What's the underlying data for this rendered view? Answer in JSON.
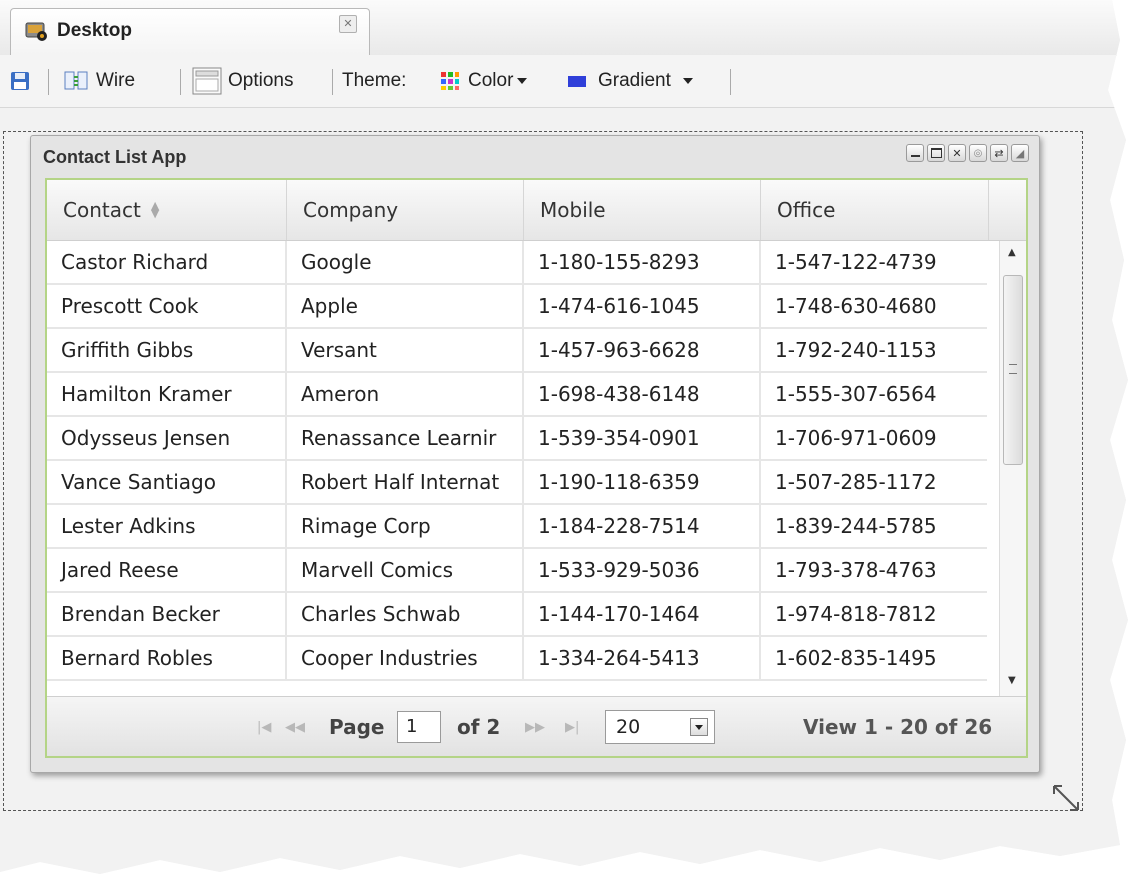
{
  "tab": {
    "title": "Desktop"
  },
  "toolbar": {
    "wire_label": "Wire",
    "options_label": "Options",
    "theme_label": "Theme:",
    "color_label": "Color",
    "gradient_label": "Gradient"
  },
  "window": {
    "title": "Contact List App"
  },
  "grid": {
    "columns": [
      "Contact",
      "Company",
      "Mobile",
      "Office"
    ],
    "rows": [
      [
        "Castor Richard",
        "Google",
        "1-180-155-8293",
        "1-547-122-4739"
      ],
      [
        "Prescott Cook",
        "Apple",
        "1-474-616-1045",
        "1-748-630-4680"
      ],
      [
        "Griffith Gibbs",
        "Versant",
        "1-457-963-6628",
        "1-792-240-1153"
      ],
      [
        "Hamilton Kramer",
        "Ameron",
        "1-698-438-6148",
        "1-555-307-6564"
      ],
      [
        "Odysseus Jensen",
        "Renassance Learnir",
        "1-539-354-0901",
        "1-706-971-0609"
      ],
      [
        "Vance Santiago",
        "Robert Half Internat",
        "1-190-118-6359",
        "1-507-285-1172"
      ],
      [
        "Lester Adkins",
        "Rimage Corp",
        "1-184-228-7514",
        "1-839-244-5785"
      ],
      [
        "Jared Reese",
        "Marvell Comics",
        "1-533-929-5036",
        "1-793-378-4763"
      ],
      [
        "Brendan Becker",
        "Charles Schwab",
        "1-144-170-1464",
        "1-974-818-7812"
      ],
      [
        "Bernard Robles",
        "Cooper Industries",
        "1-334-264-5413",
        "1-602-835-1495"
      ]
    ]
  },
  "pager": {
    "page_label": "Page",
    "page_value": "1",
    "of_label": "of 2",
    "rows_per_page": "20",
    "view_text": "View 1 - 20 of 26"
  },
  "colors": {
    "grid_border": "#b4d486",
    "accent_blue": "#3b6fd6"
  }
}
